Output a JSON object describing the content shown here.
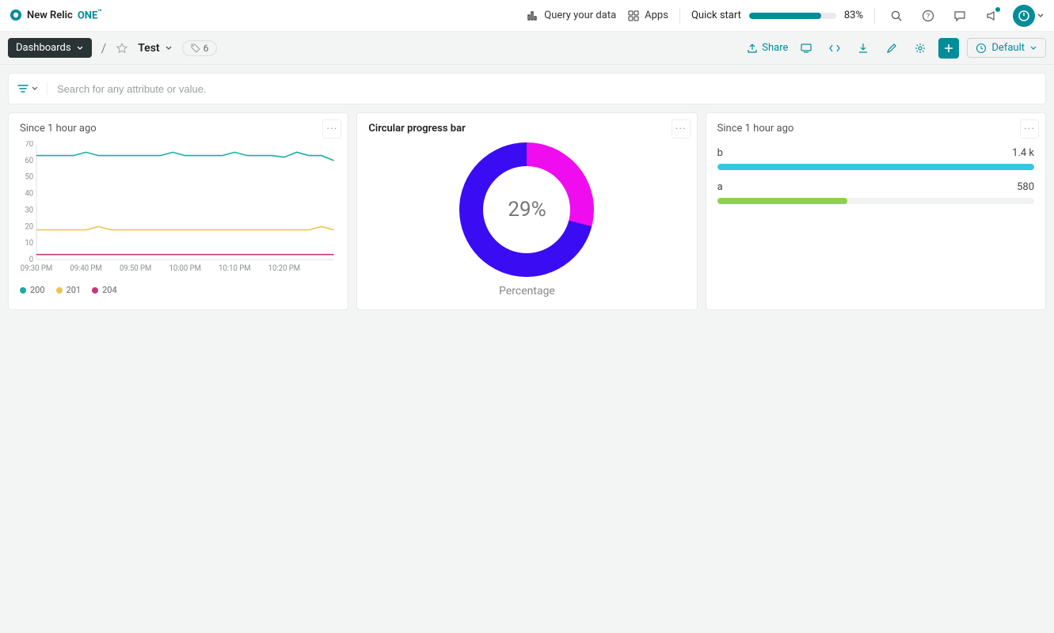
{
  "brand": {
    "name": "New Relic",
    "product": "ONE",
    "tm": "™"
  },
  "top": {
    "query": "Query your data",
    "apps": "Apps",
    "quickstart_label": "Quick start",
    "quickstart_pct": 83,
    "quickstart_pct_label": "83%"
  },
  "subbar": {
    "dashboards": "Dashboards",
    "tab": "Test",
    "tag_count": "6",
    "share": "Share",
    "range": "Default"
  },
  "filter": {
    "placeholder": "Search for any attribute or value."
  },
  "cards": {
    "line": {
      "title": "Since 1 hour ago",
      "legend": [
        {
          "name": "200",
          "color": "#1aaaa5"
        },
        {
          "name": "201",
          "color": "#f0c24b"
        },
        {
          "name": "204",
          "color": "#c9367d"
        }
      ]
    },
    "donut": {
      "title": "Circular progress bar",
      "value": 29,
      "value_label": "29%",
      "sublabel": "Percentage",
      "colors": {
        "filled": "#3a0cf3",
        "remaining": "#ef0cef"
      }
    },
    "bars": {
      "title": "Since 1 hour ago",
      "items": [
        {
          "label": "b",
          "value_label": "1.4 k",
          "pct": 100,
          "color": "#35c6e3"
        },
        {
          "label": "a",
          "value_label": "580",
          "pct": 41,
          "color": "#8fd14f"
        }
      ]
    }
  },
  "chart_data": [
    {
      "type": "line",
      "title": "Since 1 hour ago",
      "ylim": [
        0,
        70
      ],
      "yticks": [
        0,
        10,
        20,
        30,
        40,
        50,
        60,
        70
      ],
      "categories": [
        "09:30 PM",
        "09:40 PM",
        "09:50 PM",
        "10:00 PM",
        "10:10 PM",
        "10:20 PM"
      ],
      "x": [
        0,
        1,
        2,
        3,
        4,
        5,
        6,
        7,
        8,
        9,
        10,
        11,
        12,
        13,
        14,
        15,
        16,
        17,
        18,
        19,
        20,
        21,
        22,
        23,
        24
      ],
      "series": [
        {
          "name": "200",
          "color": "#1aaaa5",
          "values": [
            63,
            63,
            63,
            63,
            65,
            63,
            63,
            63,
            63,
            63,
            63,
            65,
            63,
            63,
            63,
            63,
            65,
            63,
            63,
            63,
            62,
            65,
            63,
            63,
            60
          ]
        },
        {
          "name": "201",
          "color": "#f0c24b",
          "values": [
            18,
            18,
            18,
            18,
            18,
            20,
            18,
            18,
            18,
            18,
            18,
            18,
            18,
            18,
            18,
            18,
            18,
            18,
            18,
            18,
            18,
            18,
            18,
            20,
            18
          ]
        },
        {
          "name": "204",
          "color": "#c9367d",
          "values": [
            3,
            3,
            3,
            3,
            3,
            3,
            3,
            3,
            3,
            3,
            3,
            3,
            3,
            3,
            3,
            3,
            3,
            3,
            3,
            3,
            3,
            3,
            3,
            3,
            3
          ]
        }
      ]
    },
    {
      "type": "pie",
      "title": "Circular progress bar",
      "series": [
        {
          "name": "Percentage",
          "values": [
            29,
            71
          ]
        }
      ],
      "annotations": [
        "29%"
      ]
    },
    {
      "type": "bar",
      "title": "Since 1 hour ago",
      "categories": [
        "b",
        "a"
      ],
      "values": [
        1400,
        580
      ]
    }
  ]
}
